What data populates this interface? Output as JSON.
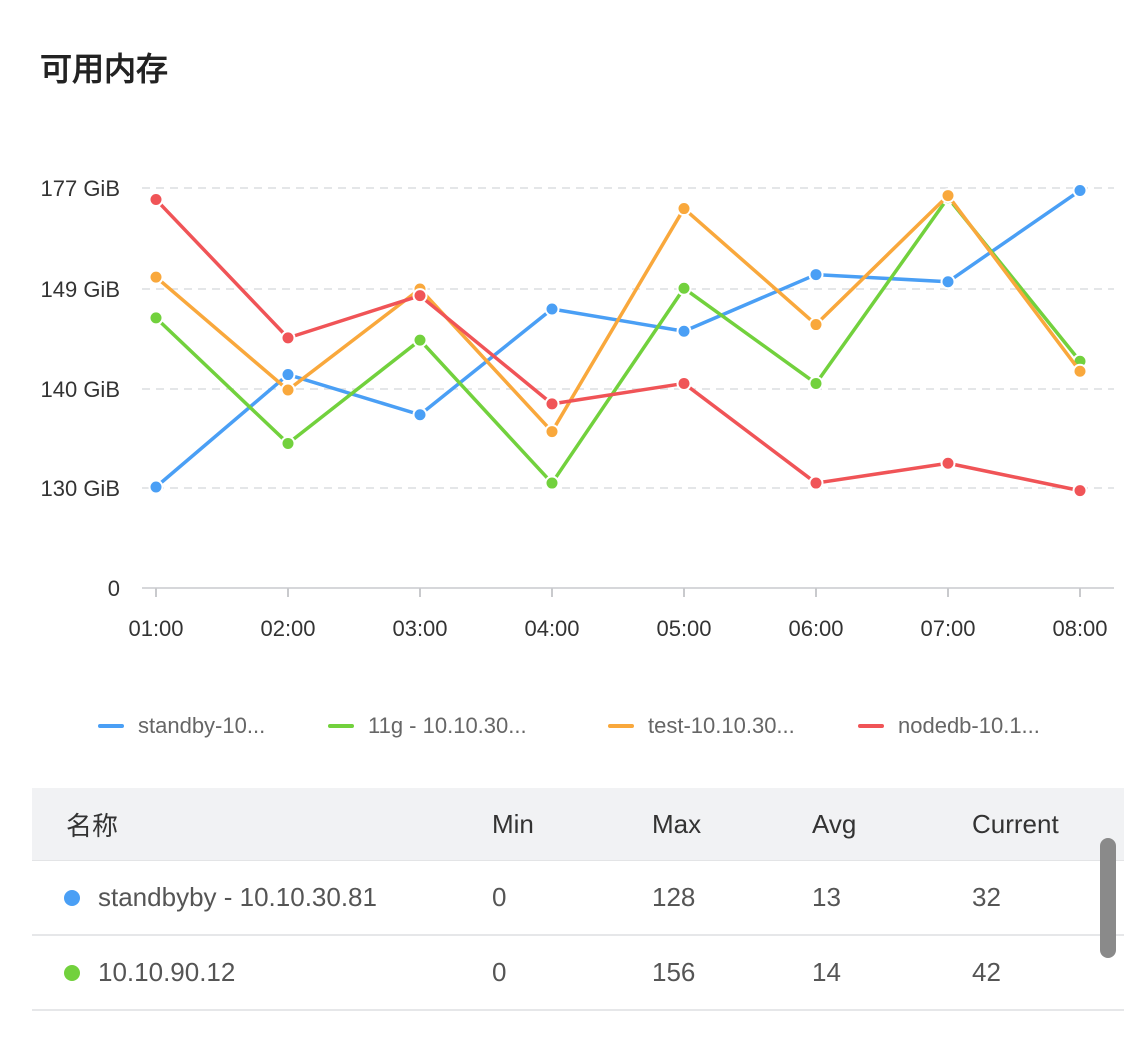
{
  "header": {
    "title": "可用内存"
  },
  "chart_data": {
    "type": "line",
    "title": "可用内存",
    "x": [
      "01:00",
      "02:00",
      "03:00",
      "04:00",
      "05:00",
      "06:00",
      "07:00",
      "08:00"
    ],
    "y_ticks": [
      {
        "label": "0",
        "value": 0
      },
      {
        "label": "130 GiB",
        "value": 130
      },
      {
        "label": "140 GiB",
        "value": 140
      },
      {
        "label": "149 GiB",
        "value": 149
      },
      {
        "label": "177  GiB",
        "value": 177
      }
    ],
    "grid": true,
    "legend_position": "bottom",
    "series": [
      {
        "name": "standby-10...",
        "color": "#4a9ff5",
        "values": [
          130.1,
          141.3,
          137.4,
          147.2,
          145.2,
          153.0,
          151.0,
          176.3
        ]
      },
      {
        "name": "11g - 10.10.30...",
        "color": "#72d13d",
        "values": [
          146.4,
          134.5,
          144.4,
          130.5,
          149.2,
          140.5,
          174.3,
          142.5
        ]
      },
      {
        "name": "test-10.10.30...",
        "color": "#f9a83c",
        "values": [
          152.3,
          139.9,
          149.0,
          135.7,
          171.3,
          145.8,
          174.9,
          141.6
        ]
      },
      {
        "name": "nodedb-10.1...",
        "color": "#f05457",
        "values": [
          173.8,
          144.6,
          148.4,
          138.5,
          140.5,
          130.5,
          132.5,
          126.6
        ]
      }
    ]
  },
  "table": {
    "headers": [
      "名称",
      "Min",
      "Max",
      "Avg",
      "Current"
    ],
    "rows": [
      {
        "color": "#4a9ff5",
        "name": "standbyby - 10.10.30.81",
        "min": "0",
        "max": "128",
        "avg": "13",
        "current": "32"
      },
      {
        "color": "#72d13d",
        "name": "10.10.90.12",
        "min": "0",
        "max": "156",
        "avg": "14",
        "current": "42"
      }
    ]
  }
}
